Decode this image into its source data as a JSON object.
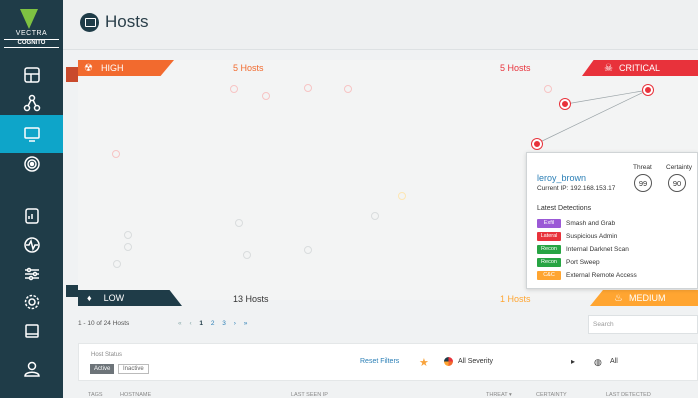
{
  "app": {
    "logo": "VECTRA",
    "logo_sub": "COGNITO"
  },
  "header": {
    "title": "Hosts",
    "icon": "monitor-icon"
  },
  "sidebar": {
    "items": [
      {
        "name": "dashboard-icon",
        "active": false
      },
      {
        "name": "network-graph-icon",
        "active": false
      },
      {
        "name": "hosts-icon",
        "active": true
      },
      {
        "name": "detections-target-icon",
        "active": false
      },
      {
        "name": "reports-icon",
        "active": false
      },
      {
        "name": "health-icon",
        "active": false
      },
      {
        "name": "manage-sliders-icon",
        "active": false
      },
      {
        "name": "settings-gear-icon",
        "active": false
      },
      {
        "name": "notes-icon",
        "active": false
      },
      {
        "name": "user-icon",
        "active": false
      }
    ]
  },
  "quadrants": {
    "high": {
      "label": "HIGH",
      "count": "5 Hosts",
      "color": "#f26a2e"
    },
    "critical": {
      "label": "CRITICAL",
      "count": "5 Hosts",
      "color": "#e8323b"
    },
    "low": {
      "label": "LOW",
      "count": "13 Hosts",
      "color": "#1f3c48"
    },
    "medium": {
      "label": "MEDIUM",
      "count": "1 Hosts",
      "color": "#ffa531"
    }
  },
  "popup": {
    "hostname": "leroy_brown",
    "ip_label": "Current IP: 192.168.153.17",
    "threat_label": "Threat",
    "certainty_label": "Certainty",
    "threat": "99",
    "certainty": "90",
    "latest_label": "Latest Detections",
    "detections": [
      {
        "tag": "Exfil",
        "color": "#9b59d6",
        "name": "Smash and Grab"
      },
      {
        "tag": "Lateral",
        "color": "#e8323b",
        "name": "Suspicious Admin"
      },
      {
        "tag": "Recon",
        "color": "#27a443",
        "name": "Internal Darknet Scan"
      },
      {
        "tag": "Recon",
        "color": "#27a443",
        "name": "Port Sweep"
      },
      {
        "tag": "C&C",
        "color": "#ffa531",
        "name": "External Remote Access"
      }
    ]
  },
  "pagination": {
    "summary": "1 - 10 of 24 Hosts",
    "first": "«",
    "prev": "‹",
    "pages": [
      "1",
      "2",
      "3"
    ],
    "next": "›",
    "last": "»"
  },
  "search": {
    "placeholder": "Search"
  },
  "filters": {
    "host_status_label": "Host Status",
    "active_label": "Active",
    "inactive_label": "Inactive",
    "reset_label": "Reset Filters",
    "severity_label": "All Severity",
    "all_label": "All"
  },
  "table": {
    "columns": [
      "TAGS",
      "HOSTNAME",
      "LAST SEEN IP",
      "THREAT ▾",
      "CERTAINTY",
      "LAST DETECTED"
    ]
  }
}
